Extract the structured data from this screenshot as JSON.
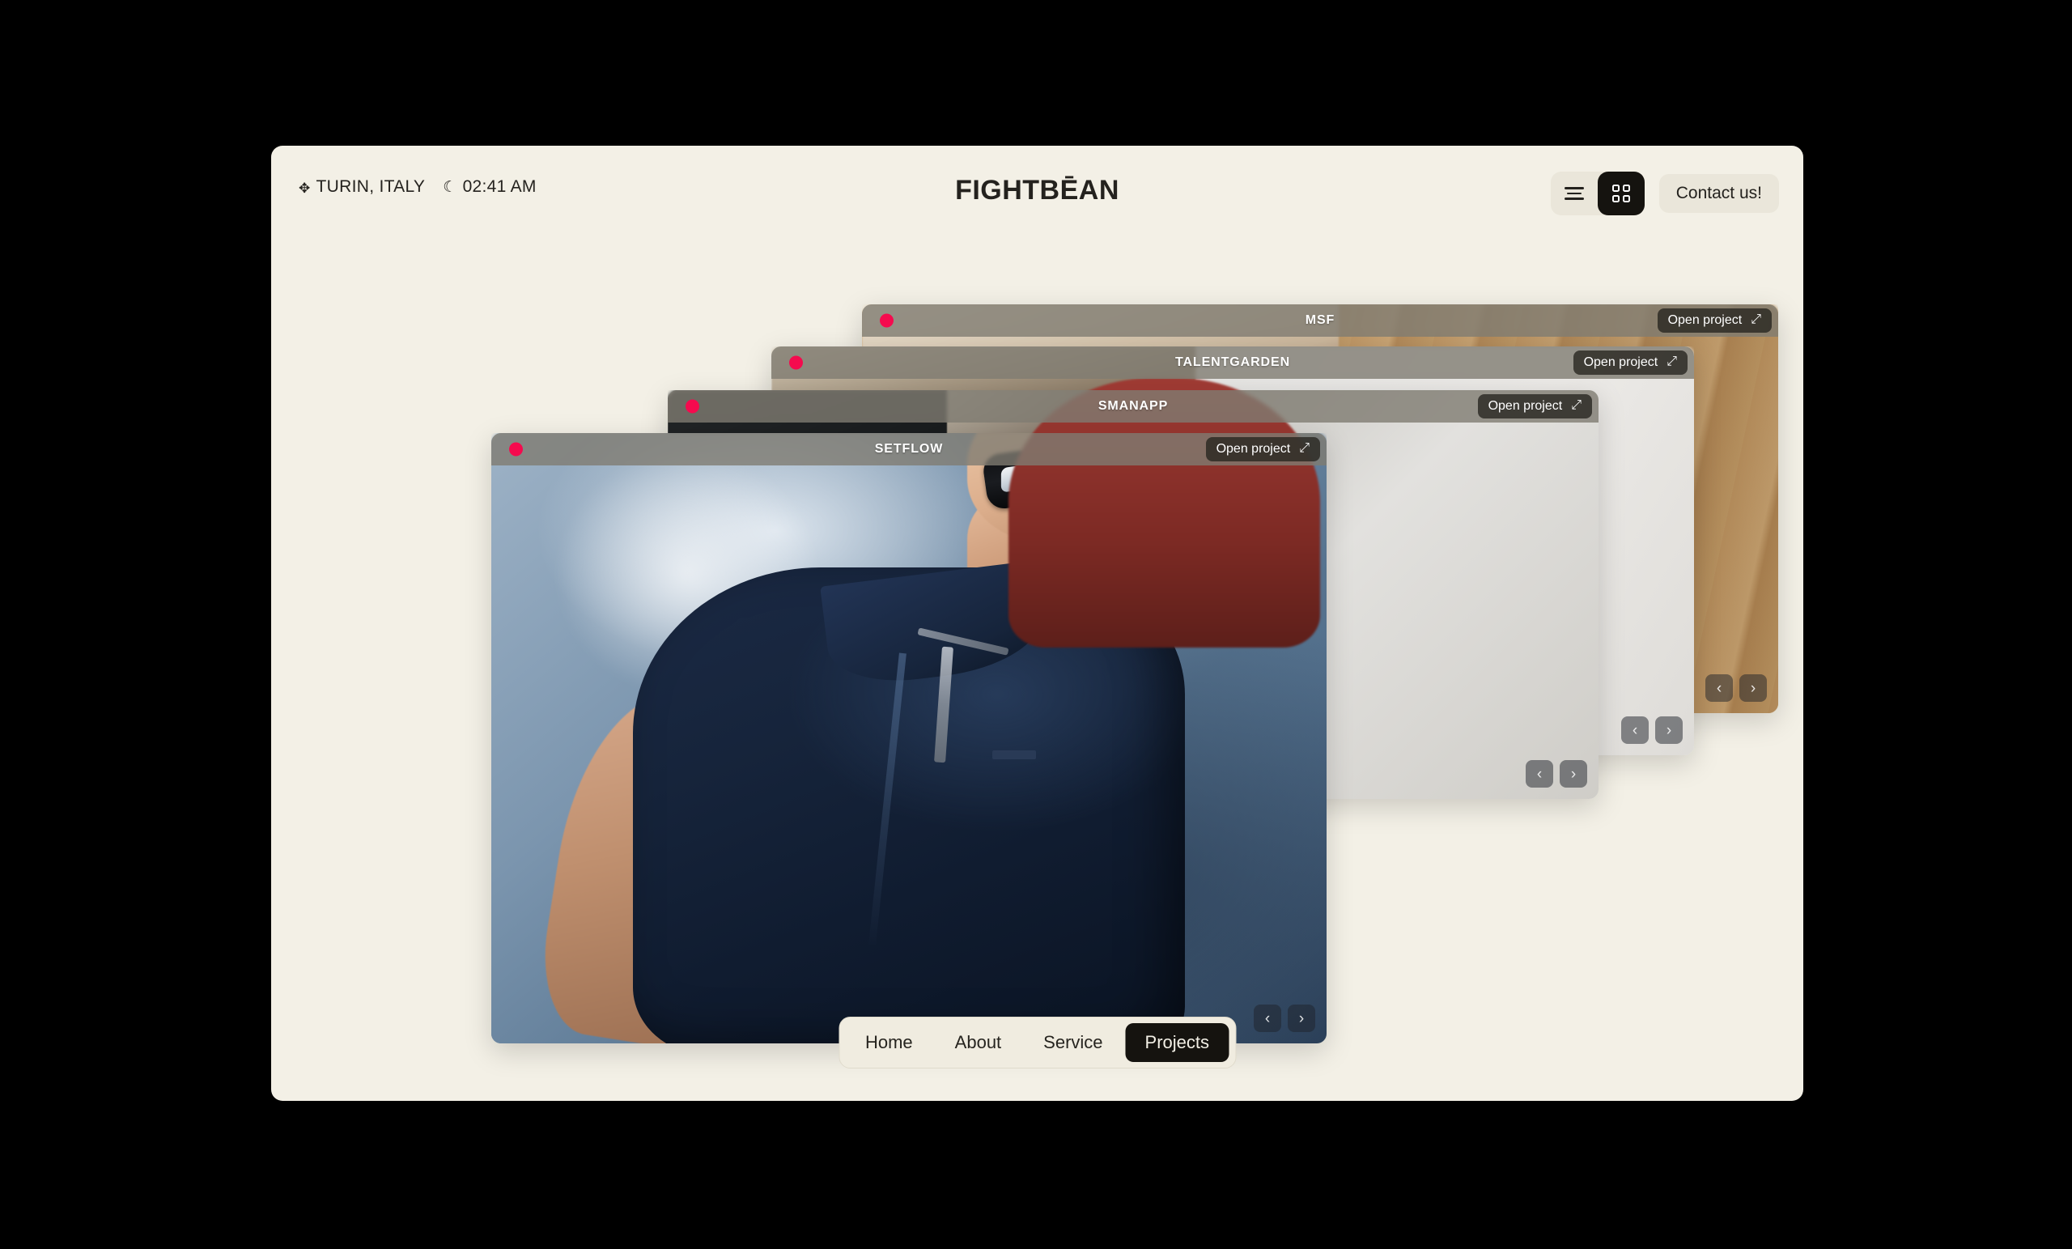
{
  "header": {
    "location_icon": "compass-star-icon",
    "location": "TURIN, ITALY",
    "time_icon": "crescent-moon-icon",
    "time": "02:41 AM",
    "brand": "FIGHTBĒAN",
    "view_list_label": "list-view",
    "view_grid_label": "grid-view",
    "active_view": "grid",
    "contact_label": "Contact us!"
  },
  "projects": [
    {
      "title": "MSF",
      "open_label": "Open project",
      "status_dot": "#f50a4e",
      "prev_label": "‹",
      "next_label": "›"
    },
    {
      "title": "TALENTGARDEN",
      "open_label": "Open project",
      "status_dot": "#f50a4e",
      "prev_label": "‹",
      "next_label": "›"
    },
    {
      "title": "SMANAPP",
      "open_label": "Open project",
      "status_dot": "#f50a4e",
      "prev_label": "‹",
      "next_label": "›"
    },
    {
      "title": "SETFLOW",
      "open_label": "Open project",
      "status_dot": "#f50a4e",
      "prev_label": "‹",
      "next_label": "›"
    }
  ],
  "bottom_nav": {
    "items": [
      {
        "label": "Home",
        "active": false
      },
      {
        "label": "About",
        "active": false
      },
      {
        "label": "Service",
        "active": false
      },
      {
        "label": "Projects",
        "active": true
      }
    ]
  },
  "colors": {
    "page_bg": "#f3f0e6",
    "outer_bg": "#000000",
    "accent_dot": "#f50a4e",
    "ink": "#24221e",
    "chip_bg": "#eae6da",
    "active_bg": "#15130f"
  },
  "icons": {
    "expand_arrow": "↗",
    "open_arrow_glyph": "⤢"
  }
}
